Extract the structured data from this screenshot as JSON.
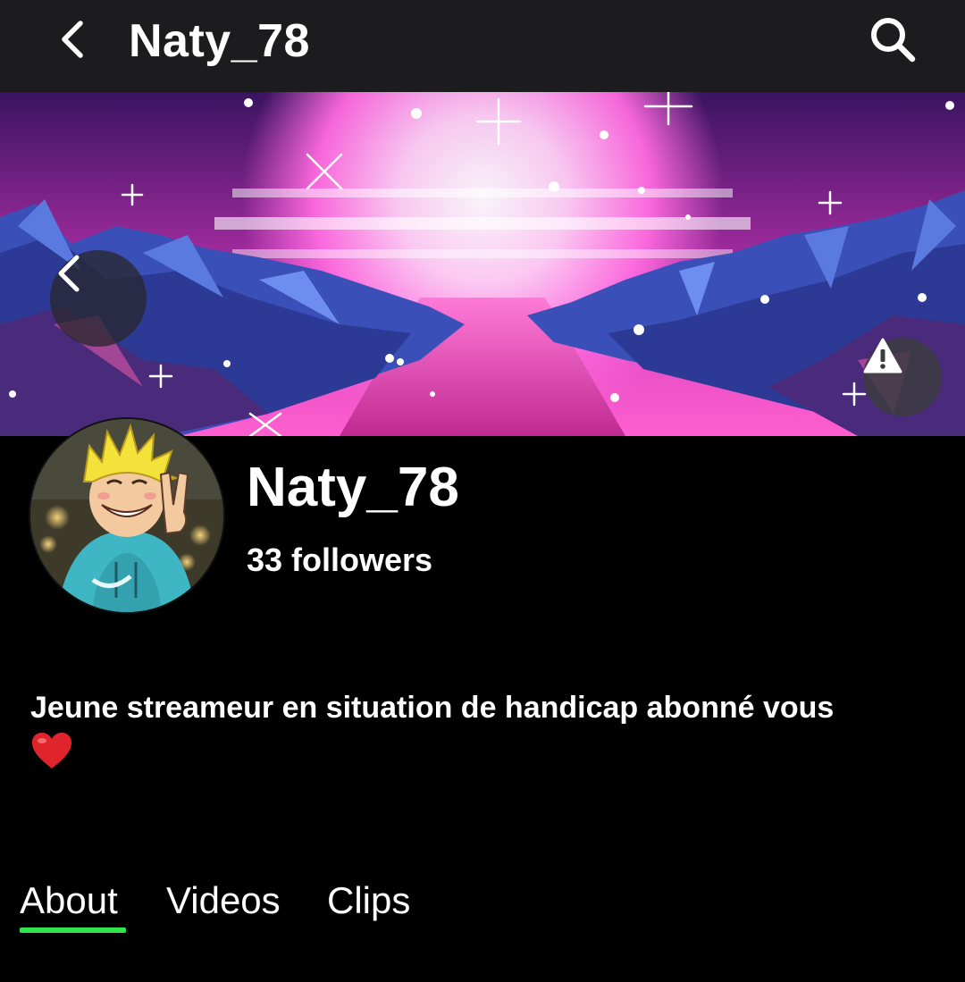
{
  "header": {
    "title": "Naty_78",
    "back_icon": "chevron-left-icon",
    "search_icon": "search-icon"
  },
  "banner": {
    "back_icon": "chevron-left-icon",
    "report_icon": "warning-icon"
  },
  "profile": {
    "name": "Naty_78",
    "followers": "33 followers",
    "bio": "Jeune streameur en situation de handicap abonné vous"
  },
  "tabs": [
    {
      "label": "About",
      "active": true
    },
    {
      "label": "Videos",
      "active": false
    },
    {
      "label": "Clips",
      "active": false
    }
  ],
  "colors": {
    "topbar_bg": "#1c1c1e",
    "page_bg": "#000000",
    "accent": "#2ee64a",
    "text": "#ffffff"
  }
}
